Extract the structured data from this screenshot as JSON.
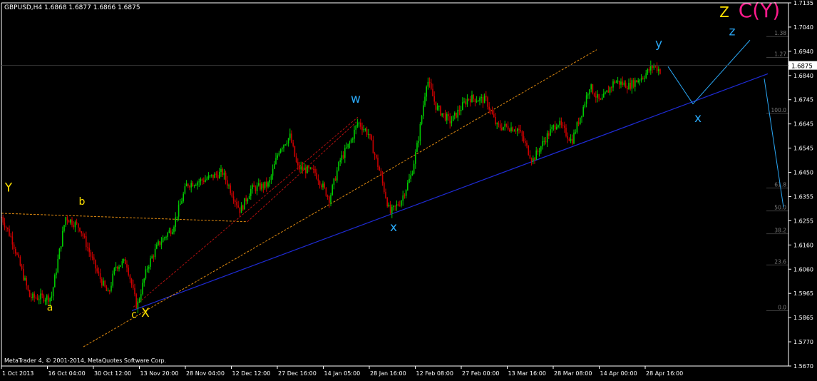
{
  "header": {
    "symbol_line": "GBPUSD,H4  1.6868 1.6877 1.6866 1.6875"
  },
  "footer": {
    "copyright": "MetaTrader 4, © 2001-2014, MetaQuotes Software Corp."
  },
  "colors": {
    "background": "#000000",
    "axis": "#ffffff",
    "candle_up": "#00cc00",
    "candle_down": "#cc0000",
    "wave_yellow": "#ffe000",
    "wave_blue": "#2aa7f5",
    "wave_magenta": "#ff1a8c",
    "trend_blue": "#1f2bd6",
    "fib_gray": "#7a7a7a",
    "price_tag": "#ffffff"
  },
  "chart_data": {
    "type": "candlestick",
    "timeframe": "H4",
    "symbol": "GBPUSD",
    "ohlc_current": {
      "open": 1.6868,
      "high": 1.6877,
      "low": 1.6866,
      "close": 1.6875
    },
    "current_price_label": "1.6875",
    "ylim": [
      1.5625,
      1.7135
    ],
    "y_ticks": [
      "1.7135",
      "1.7040",
      "1.6940",
      "1.6840",
      "1.6745",
      "1.6645",
      "1.6545",
      "1.6450",
      "1.6355",
      "1.6255",
      "1.6160",
      "1.6060",
      "1.5965",
      "1.5865",
      "1.5770",
      "1.5670"
    ],
    "x_ticks": [
      "1 Oct 2013",
      "16 Oct 04:00",
      "30 Oct 12:00",
      "13 Nov 20:00",
      "28 Nov 04:00",
      "12 Dec 12:00",
      "27 Dec 16:00",
      "14 Jan 05:00",
      "28 Jan 16:00",
      "12 Feb 08:00",
      "27 Feb 00:00",
      "13 Mar 16:00",
      "28 Mar 08:00",
      "14 Apr 00:00",
      "28 Apr 16:00"
    ],
    "price_path": [
      {
        "x": 0,
        "y": 1.6245
      },
      {
        "x": 15,
        "y": 1.615
      },
      {
        "x": 40,
        "y": 1.591
      },
      {
        "x": 70,
        "y": 1.591
      },
      {
        "x": 90,
        "y": 1.6245
      },
      {
        "x": 110,
        "y": 1.62
      },
      {
        "x": 135,
        "y": 1.601
      },
      {
        "x": 150,
        "y": 1.592
      },
      {
        "x": 160,
        "y": 1.604
      },
      {
        "x": 175,
        "y": 1.606
      },
      {
        "x": 190,
        "y": 1.587
      },
      {
        "x": 205,
        "y": 1.604
      },
      {
        "x": 220,
        "y": 1.613
      },
      {
        "x": 240,
        "y": 1.62
      },
      {
        "x": 260,
        "y": 1.638
      },
      {
        "x": 285,
        "y": 1.64
      },
      {
        "x": 310,
        "y": 1.643
      },
      {
        "x": 335,
        "y": 1.627
      },
      {
        "x": 350,
        "y": 1.636
      },
      {
        "x": 375,
        "y": 1.638
      },
      {
        "x": 390,
        "y": 1.653
      },
      {
        "x": 405,
        "y": 1.658
      },
      {
        "x": 415,
        "y": 1.645
      },
      {
        "x": 440,
        "y": 1.643
      },
      {
        "x": 460,
        "y": 1.632
      },
      {
        "x": 475,
        "y": 1.648
      },
      {
        "x": 490,
        "y": 1.656
      },
      {
        "x": 500,
        "y": 1.664
      },
      {
        "x": 515,
        "y": 1.659
      },
      {
        "x": 530,
        "y": 1.644
      },
      {
        "x": 545,
        "y": 1.626
      },
      {
        "x": 560,
        "y": 1.631
      },
      {
        "x": 575,
        "y": 1.642
      },
      {
        "x": 585,
        "y": 1.657
      },
      {
        "x": 597,
        "y": 1.682
      },
      {
        "x": 610,
        "y": 1.67
      },
      {
        "x": 630,
        "y": 1.664
      },
      {
        "x": 655,
        "y": 1.674
      },
      {
        "x": 680,
        "y": 1.673
      },
      {
        "x": 695,
        "y": 1.662
      },
      {
        "x": 710,
        "y": 1.662
      },
      {
        "x": 725,
        "y": 1.661
      },
      {
        "x": 745,
        "y": 1.648
      },
      {
        "x": 765,
        "y": 1.658
      },
      {
        "x": 780,
        "y": 1.664
      },
      {
        "x": 800,
        "y": 1.656
      },
      {
        "x": 815,
        "y": 1.669
      },
      {
        "x": 825,
        "y": 1.679
      },
      {
        "x": 840,
        "y": 1.672
      },
      {
        "x": 860,
        "y": 1.681
      },
      {
        "x": 880,
        "y": 1.679
      },
      {
        "x": 900,
        "y": 1.683
      },
      {
        "x": 915,
        "y": 1.6875
      },
      {
        "x": 925,
        "y": 1.685
      }
    ],
    "wave_labels": [
      {
        "text": "Y",
        "x": 10,
        "y": 1.635,
        "color": "wave_yellow",
        "size": 17
      },
      {
        "text": "b",
        "x": 113,
        "y": 1.6295,
        "color": "wave_yellow",
        "size": 14
      },
      {
        "text": "a",
        "x": 68,
        "y": 1.5855,
        "color": "wave_yellow",
        "size": 14
      },
      {
        "text": "c",
        "x": 186,
        "y": 1.5825,
        "color": "wave_yellow",
        "size": 14
      },
      {
        "text": "X",
        "x": 202,
        "y": 1.583,
        "color": "wave_yellow",
        "size": 17
      },
      {
        "text": "w",
        "x": 497,
        "y": 1.672,
        "color": "wave_blue",
        "size": 17
      },
      {
        "text": "x",
        "x": 550,
        "y": 1.6185,
        "color": "wave_blue",
        "size": 17
      },
      {
        "text": "y",
        "x": 922,
        "y": 1.695,
        "color": "wave_blue",
        "size": 17
      },
      {
        "text": "x",
        "x": 977,
        "y": 1.664,
        "color": "wave_blue",
        "size": 17
      },
      {
        "text": "z",
        "x": 1025,
        "y": 1.7,
        "color": "wave_blue",
        "size": 17
      },
      {
        "text": "Z",
        "x": 1014,
        "y": 1.7075,
        "color": "wave_yellow",
        "size": 20
      },
      {
        "text": "C(Y)",
        "x": 1063,
        "y": 1.7075,
        "color": "wave_magenta",
        "size": 28
      }
    ],
    "fib_levels": [
      {
        "label": "1.38",
        "y": 1.6995
      },
      {
        "label": "1.27",
        "y": 1.6908
      },
      {
        "label": "100.0",
        "y": 1.6675
      },
      {
        "label": "61.8",
        "y": 1.6365
      },
      {
        "label": "50.0",
        "y": 1.627
      },
      {
        "label": "38.2",
        "y": 1.6175
      },
      {
        "label": "23.6",
        "y": 1.6045
      },
      {
        "label": "0.0",
        "y": 1.5855
      }
    ]
  }
}
